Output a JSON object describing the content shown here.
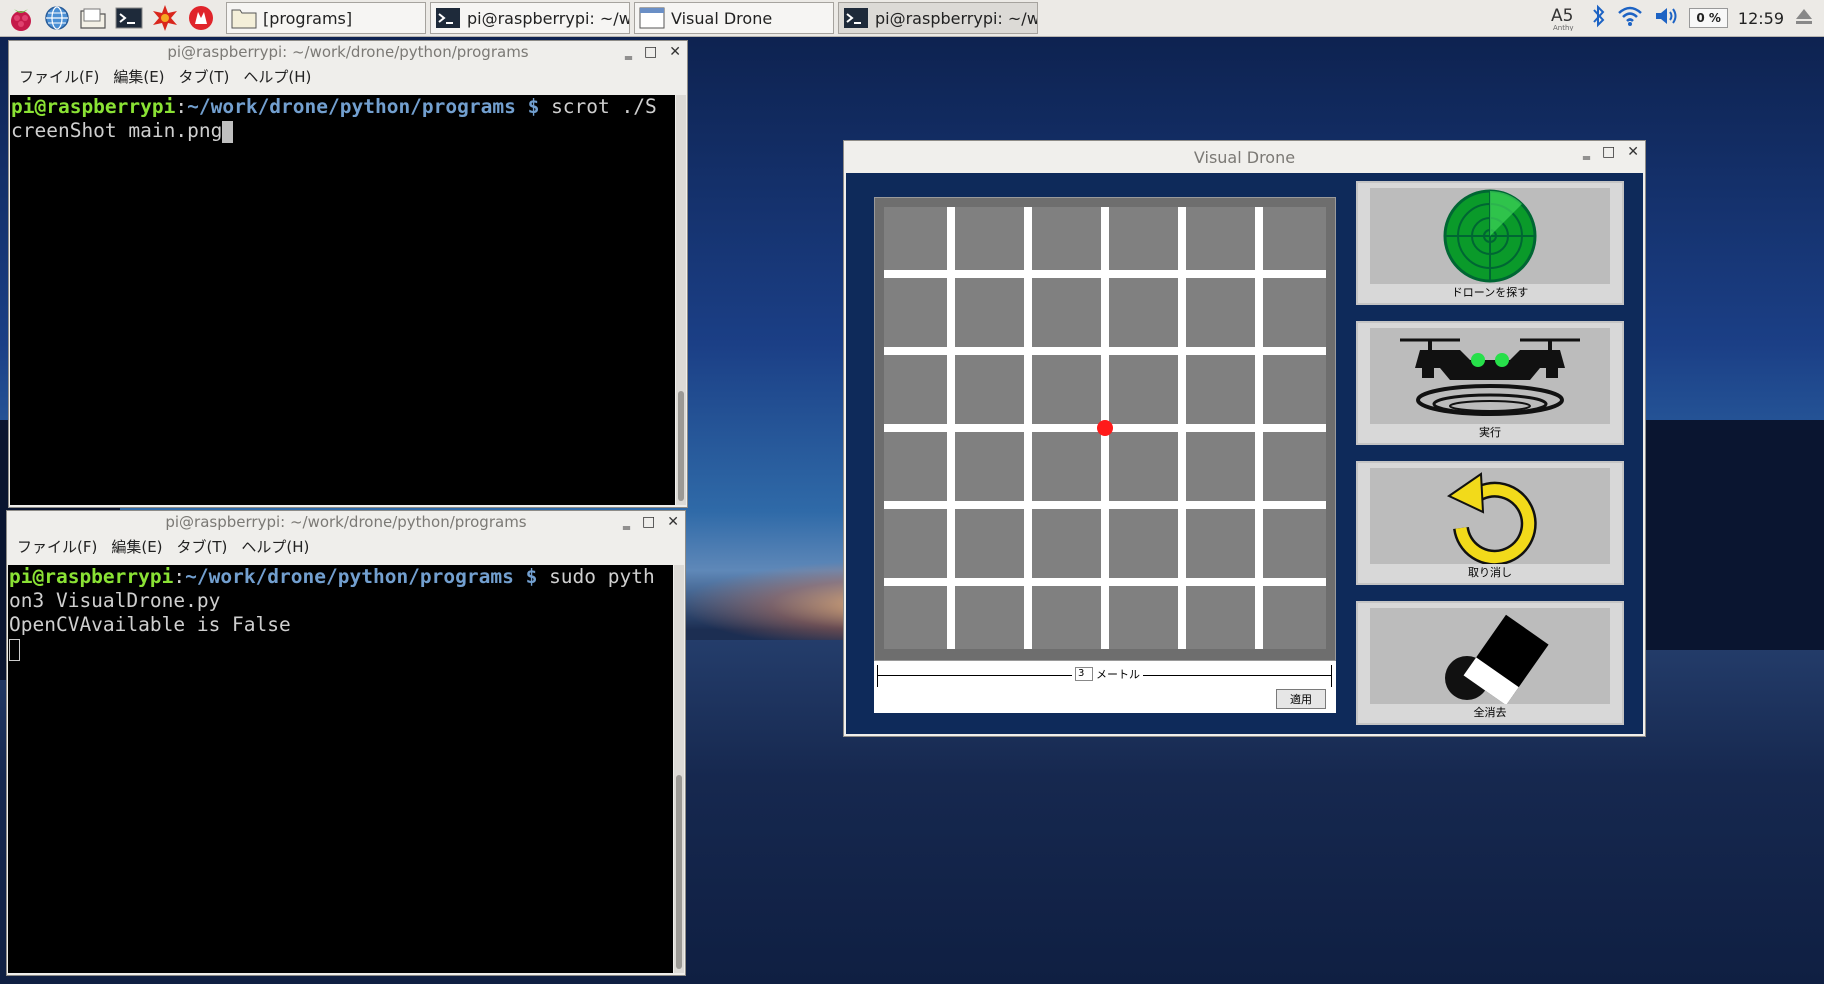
{
  "taskbar": {
    "icons": [
      "raspberry-menu-icon",
      "web-browser-icon",
      "file-manager-icon",
      "terminal-icon",
      "mathematica-icon",
      "wolfram-icon"
    ],
    "tasks": [
      {
        "label": "[programs]",
        "icon": "folder-icon"
      },
      {
        "label": "pi@raspberrypi: ~/w...",
        "icon": "terminal-icon"
      },
      {
        "label": "Visual Drone",
        "icon": "window-icon"
      },
      {
        "label": "pi@raspberrypi: ~/w...",
        "icon": "terminal-icon"
      }
    ],
    "tray": {
      "cpu": "0 %",
      "clock": "12:59"
    }
  },
  "terminal_top": {
    "title": "pi@raspberrypi: ~/work/drone/python/programs",
    "menu": [
      "ファイル(F)",
      "編集(E)",
      "タブ(T)",
      "ヘルプ(H)"
    ],
    "prompt_user": "pi@raspberrypi",
    "prompt_sep": ":",
    "prompt_path": "~/work/drone/python/programs $",
    "command_line1": " scrot ./S",
    "command_line2": "creenShot main.png"
  },
  "terminal_bottom": {
    "title": "pi@raspberrypi: ~/work/drone/python/programs",
    "menu": [
      "ファイル(F)",
      "編集(E)",
      "タブ(T)",
      "ヘルプ(H)"
    ],
    "prompt_user": "pi@raspberrypi",
    "prompt_sep": ":",
    "prompt_path": "~/work/drone/python/programs $",
    "command_line1": " sudo pyth",
    "command_line2": "on3 VisualDrone.py",
    "output": "OpenCVAvailable is False"
  },
  "visual_drone": {
    "title": "Visual Drone",
    "scale_value": "3",
    "scale_unit": "メートル",
    "apply_label": "適用",
    "tools": [
      {
        "label": "ドローンを探す",
        "icon": "radar-icon"
      },
      {
        "label": "実行",
        "icon": "drone-icon"
      },
      {
        "label": "取り消し",
        "icon": "undo-icon"
      },
      {
        "label": "全消去",
        "icon": "eraser-icon"
      }
    ],
    "colors": {
      "background": "#0e2a5a",
      "grid_cell": "#808080",
      "grid_line": "#ffffff",
      "marker": "#ff1a1a"
    }
  }
}
